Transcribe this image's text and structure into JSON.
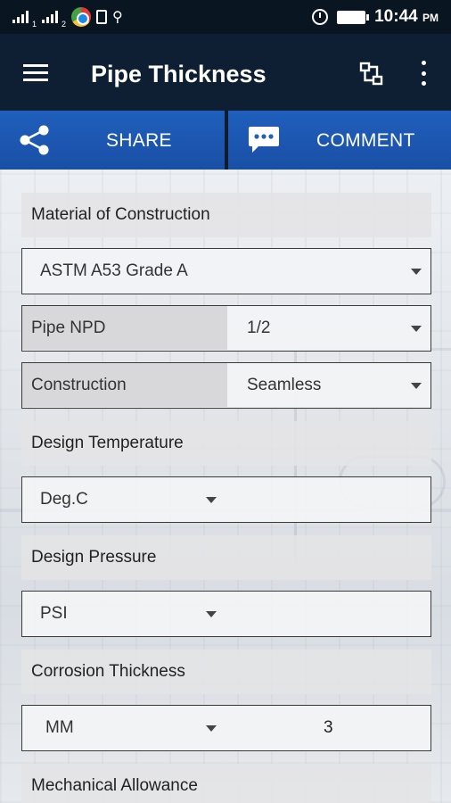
{
  "status_bar": {
    "signal1_label": "1",
    "signal2_label": "2",
    "time": "10:44",
    "ampm": "PM"
  },
  "app_bar": {
    "title": "Pipe Thickness",
    "icons": [
      "menu-icon",
      "hierarchy-icon",
      "more-vert-icon"
    ]
  },
  "actions": {
    "share_label": "SHARE",
    "comment_label": "COMMENT",
    "accent": "#1f5fbd"
  },
  "form": {
    "material_label": "Material of Construction",
    "material_value": "ASTM A53 Grade A",
    "pipe_npd_label": "Pipe NPD",
    "pipe_npd_value": "1/2",
    "construction_label": "Construction",
    "construction_value": "Seamless",
    "design_temp_label": "Design Temperature",
    "design_temp_unit": "Deg.C",
    "design_temp_value": "",
    "design_pressure_label": "Design Pressure",
    "design_pressure_unit": "PSI",
    "design_pressure_value": "",
    "corrosion_label": "Corrosion Thickness",
    "corrosion_unit": "MM",
    "corrosion_value": "3",
    "mechanical_label": "Mechanical Allowance"
  }
}
